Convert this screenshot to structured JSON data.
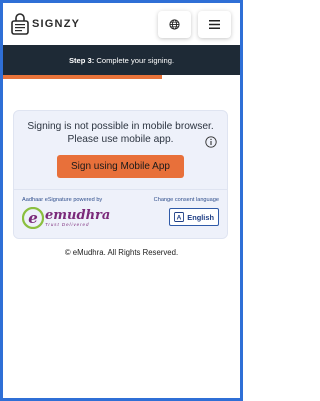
{
  "header": {
    "logo_text": "SIGNZY",
    "globe_icon": "globe-icon",
    "menu_icon": "hamburger-menu-icon"
  },
  "step": {
    "prefix": "Step 3:",
    "text": "Complete your signing.",
    "progress_fraction": 0.67
  },
  "card": {
    "message_line1": "Signing is not possible in mobile browser.",
    "message_line2": "Please use mobile app.",
    "cta_label": "Sign using Mobile App",
    "powered_by": "Aadhaar eSignature powered by",
    "provider_name": "emudhra",
    "provider_tagline": "Trust Delivered",
    "consent_label": "Change consent language",
    "language": "English"
  },
  "footer": {
    "copyright": "© eMudhra. All Rights Reserved."
  },
  "colors": {
    "accent": "#e8703a",
    "banner": "#1e2a36",
    "frame": "#2f6fd6",
    "card_bg": "#eef1fa"
  }
}
